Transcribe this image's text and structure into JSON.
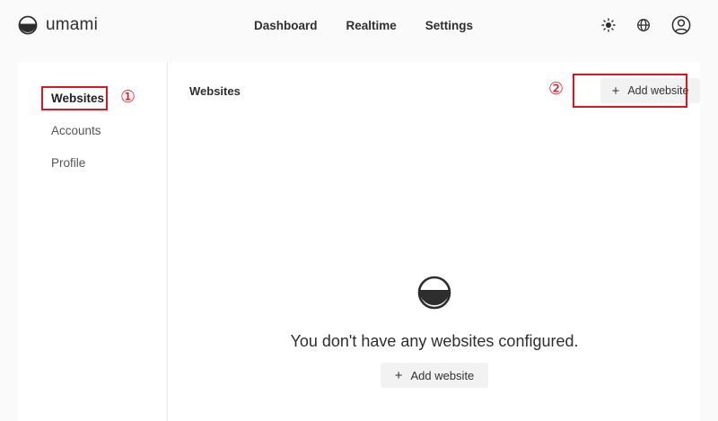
{
  "brand": {
    "name": "umami"
  },
  "topnav": {
    "items": [
      "Dashboard",
      "Realtime",
      "Settings"
    ]
  },
  "header_icons": [
    "theme-sun-icon",
    "language-globe-icon",
    "user-profile-icon"
  ],
  "sidebar": {
    "items": [
      "Websites",
      "Accounts",
      "Profile"
    ],
    "active": "Websites"
  },
  "main": {
    "title": "Websites",
    "add_button_label": "Add website",
    "empty_message": "You don't have any websites configured.",
    "empty_add_button_label": "Add website"
  },
  "annotations": {
    "callout_1": "①",
    "callout_2": "②"
  },
  "colors": {
    "annotation": "#e0141e",
    "page_bg": "#fafafa",
    "panel_bg": "#ffffff",
    "button_bg": "#f2f2f2"
  }
}
